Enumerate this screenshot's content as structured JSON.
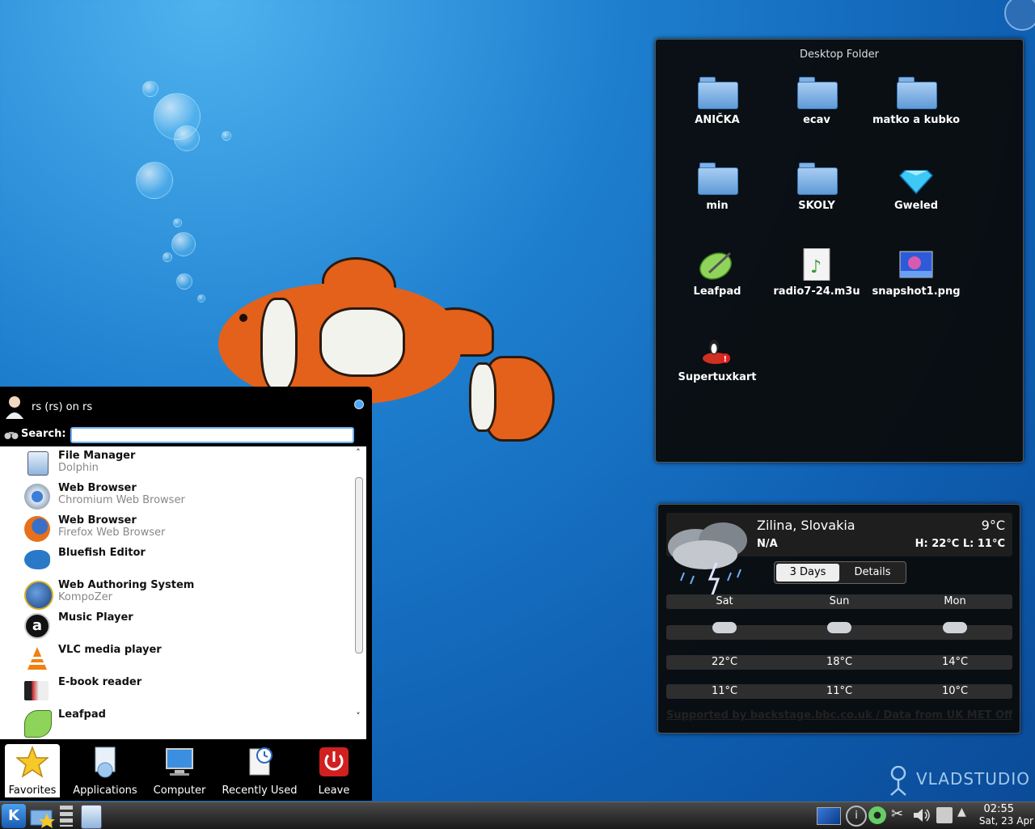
{
  "wallpaper": {
    "brand": "VLADSTUDIO"
  },
  "desktop_folder": {
    "title": "Desktop Folder",
    "items": [
      {
        "label": "ANIČKA",
        "icon": "folder-icon"
      },
      {
        "label": "ecav",
        "icon": "folder-icon"
      },
      {
        "label": "matko a kubko",
        "icon": "folder-icon"
      },
      {
        "label": "min",
        "icon": "folder-icon"
      },
      {
        "label": "SKOLY",
        "icon": "folder-icon"
      },
      {
        "label": "Gweled",
        "icon": "diamond-icon"
      },
      {
        "label": "Leafpad",
        "icon": "leafpad-icon"
      },
      {
        "label": "radio7-24.m3u",
        "icon": "music-file-icon"
      },
      {
        "label": "snapshot1.png",
        "icon": "image-file-icon"
      },
      {
        "label": "Supertuxkart",
        "icon": "supertuxkart-icon"
      }
    ]
  },
  "weather": {
    "city": "Zilina, Slovakia",
    "temp": "9°C",
    "condition": "N/A",
    "high_low": "H: 22°C L: 11°C",
    "tabs": [
      "3 Days",
      "Details"
    ],
    "days": [
      "Sat",
      "Sun",
      "Mon"
    ],
    "highs": [
      "22°C",
      "18°C",
      "14°C"
    ],
    "lows": [
      "11°C",
      "11°C",
      "10°C"
    ],
    "credit": "Supported by backstage.bbc.co.uk / Data from UK MET Office"
  },
  "menu": {
    "user": "rs (rs) on rs",
    "search_label": "Search:",
    "search_value": "",
    "favorites": [
      {
        "name": "File Manager",
        "sub": "Dolphin",
        "icon": "file-manager-icon"
      },
      {
        "name": "Web Browser",
        "sub": "Chromium Web Browser",
        "icon": "chromium-icon"
      },
      {
        "name": "Web Browser",
        "sub": "Firefox Web Browser",
        "icon": "firefox-icon"
      },
      {
        "name": "Bluefish Editor",
        "sub": "",
        "icon": "bluefish-icon"
      },
      {
        "name": "Web Authoring System",
        "sub": "KompoZer",
        "icon": "kompozer-icon"
      },
      {
        "name": "Music Player",
        "sub": "",
        "icon": "music-player-icon"
      },
      {
        "name": "VLC media player",
        "sub": "",
        "icon": "vlc-icon"
      },
      {
        "name": "E-book reader",
        "sub": "",
        "icon": "ebook-icon"
      },
      {
        "name": "Leafpad",
        "sub": "",
        "icon": "leafpad-icon"
      }
    ],
    "tabs": [
      {
        "label": "Favorites",
        "icon": "star-icon"
      },
      {
        "label": "Applications",
        "icon": "applications-icon"
      },
      {
        "label": "Computer",
        "icon": "computer-icon"
      },
      {
        "label": "Recently Used",
        "icon": "recently-used-icon"
      },
      {
        "label": "Leave",
        "icon": "power-icon"
      }
    ]
  },
  "panel": {
    "time": "02:55",
    "date": "Sat, 23 Apr"
  }
}
